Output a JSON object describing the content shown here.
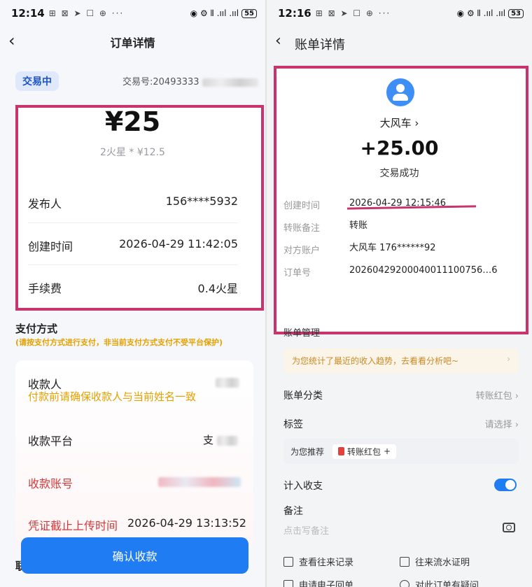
{
  "left": {
    "status": {
      "time": "12:14",
      "apps": "⊞ ⊠ ➤ ☐ ⊕ ···",
      "icons": "◉ ⚙ ⦀ .ııl .ııl",
      "battery": "55"
    },
    "title": "订单详情",
    "badge": "交易中",
    "txid": "交易号:20493333",
    "amount": "¥25",
    "sub": "2火星 * ¥12.5",
    "rows": [
      {
        "label": "发布人",
        "value": "156****5932"
      },
      {
        "label": "创建时间",
        "value": "2026-04-29 11:42:05"
      },
      {
        "label": "手续费",
        "value": "0.4火星"
      }
    ],
    "pay_title": "支付方式",
    "pay_hint": "(请按支付方式进行支付，非当前支付方式支付不受平台保护)",
    "payee_label": "收款人",
    "payee_warn": "付款前请确保收款人与当前姓名一致",
    "platform_label": "收款平台",
    "platform_value": "支",
    "account_label": "收款账号",
    "deadline_label": "凭证截止上传时间",
    "deadline_value": "2026-04-29 13:13:52",
    "confirm": "确认收款",
    "bottom": "联"
  },
  "right": {
    "status": {
      "time": "12:16",
      "apps": "⊞ ⊠ ➤ ☐ ⊕ ···",
      "icons": "◉ ⚙ ⦀ .ııl .ııl",
      "battery": "53"
    },
    "title": "账单详情",
    "name": "大风车 ›",
    "amount": "+25.00",
    "status_text": "交易成功",
    "fields": [
      {
        "k": "创建时间",
        "v": "2026-04-29 12:15:46"
      },
      {
        "k": "转账备注",
        "v": "转账"
      },
      {
        "k": "对方账户",
        "v": "大风车 176******92"
      },
      {
        "k": "订单号",
        "v": "20260429200040011100756…6"
      }
    ],
    "section": "账单管理",
    "tip": "为您统计了最近的收入趋势，去看看分析吧~",
    "category_label": "账单分类",
    "category_value": "转账红包 ›",
    "tag_label": "标签",
    "tag_value": "请选择 ›",
    "recommend_label": "为您推荐",
    "recommend_chip": "转账红包",
    "count_label": "计入收支",
    "note_label": "备注",
    "note_placeholder": "点击写备注",
    "links": [
      "查看往来记录",
      "往来流水证明",
      "申请电子回单",
      "对此订单有疑问"
    ]
  }
}
